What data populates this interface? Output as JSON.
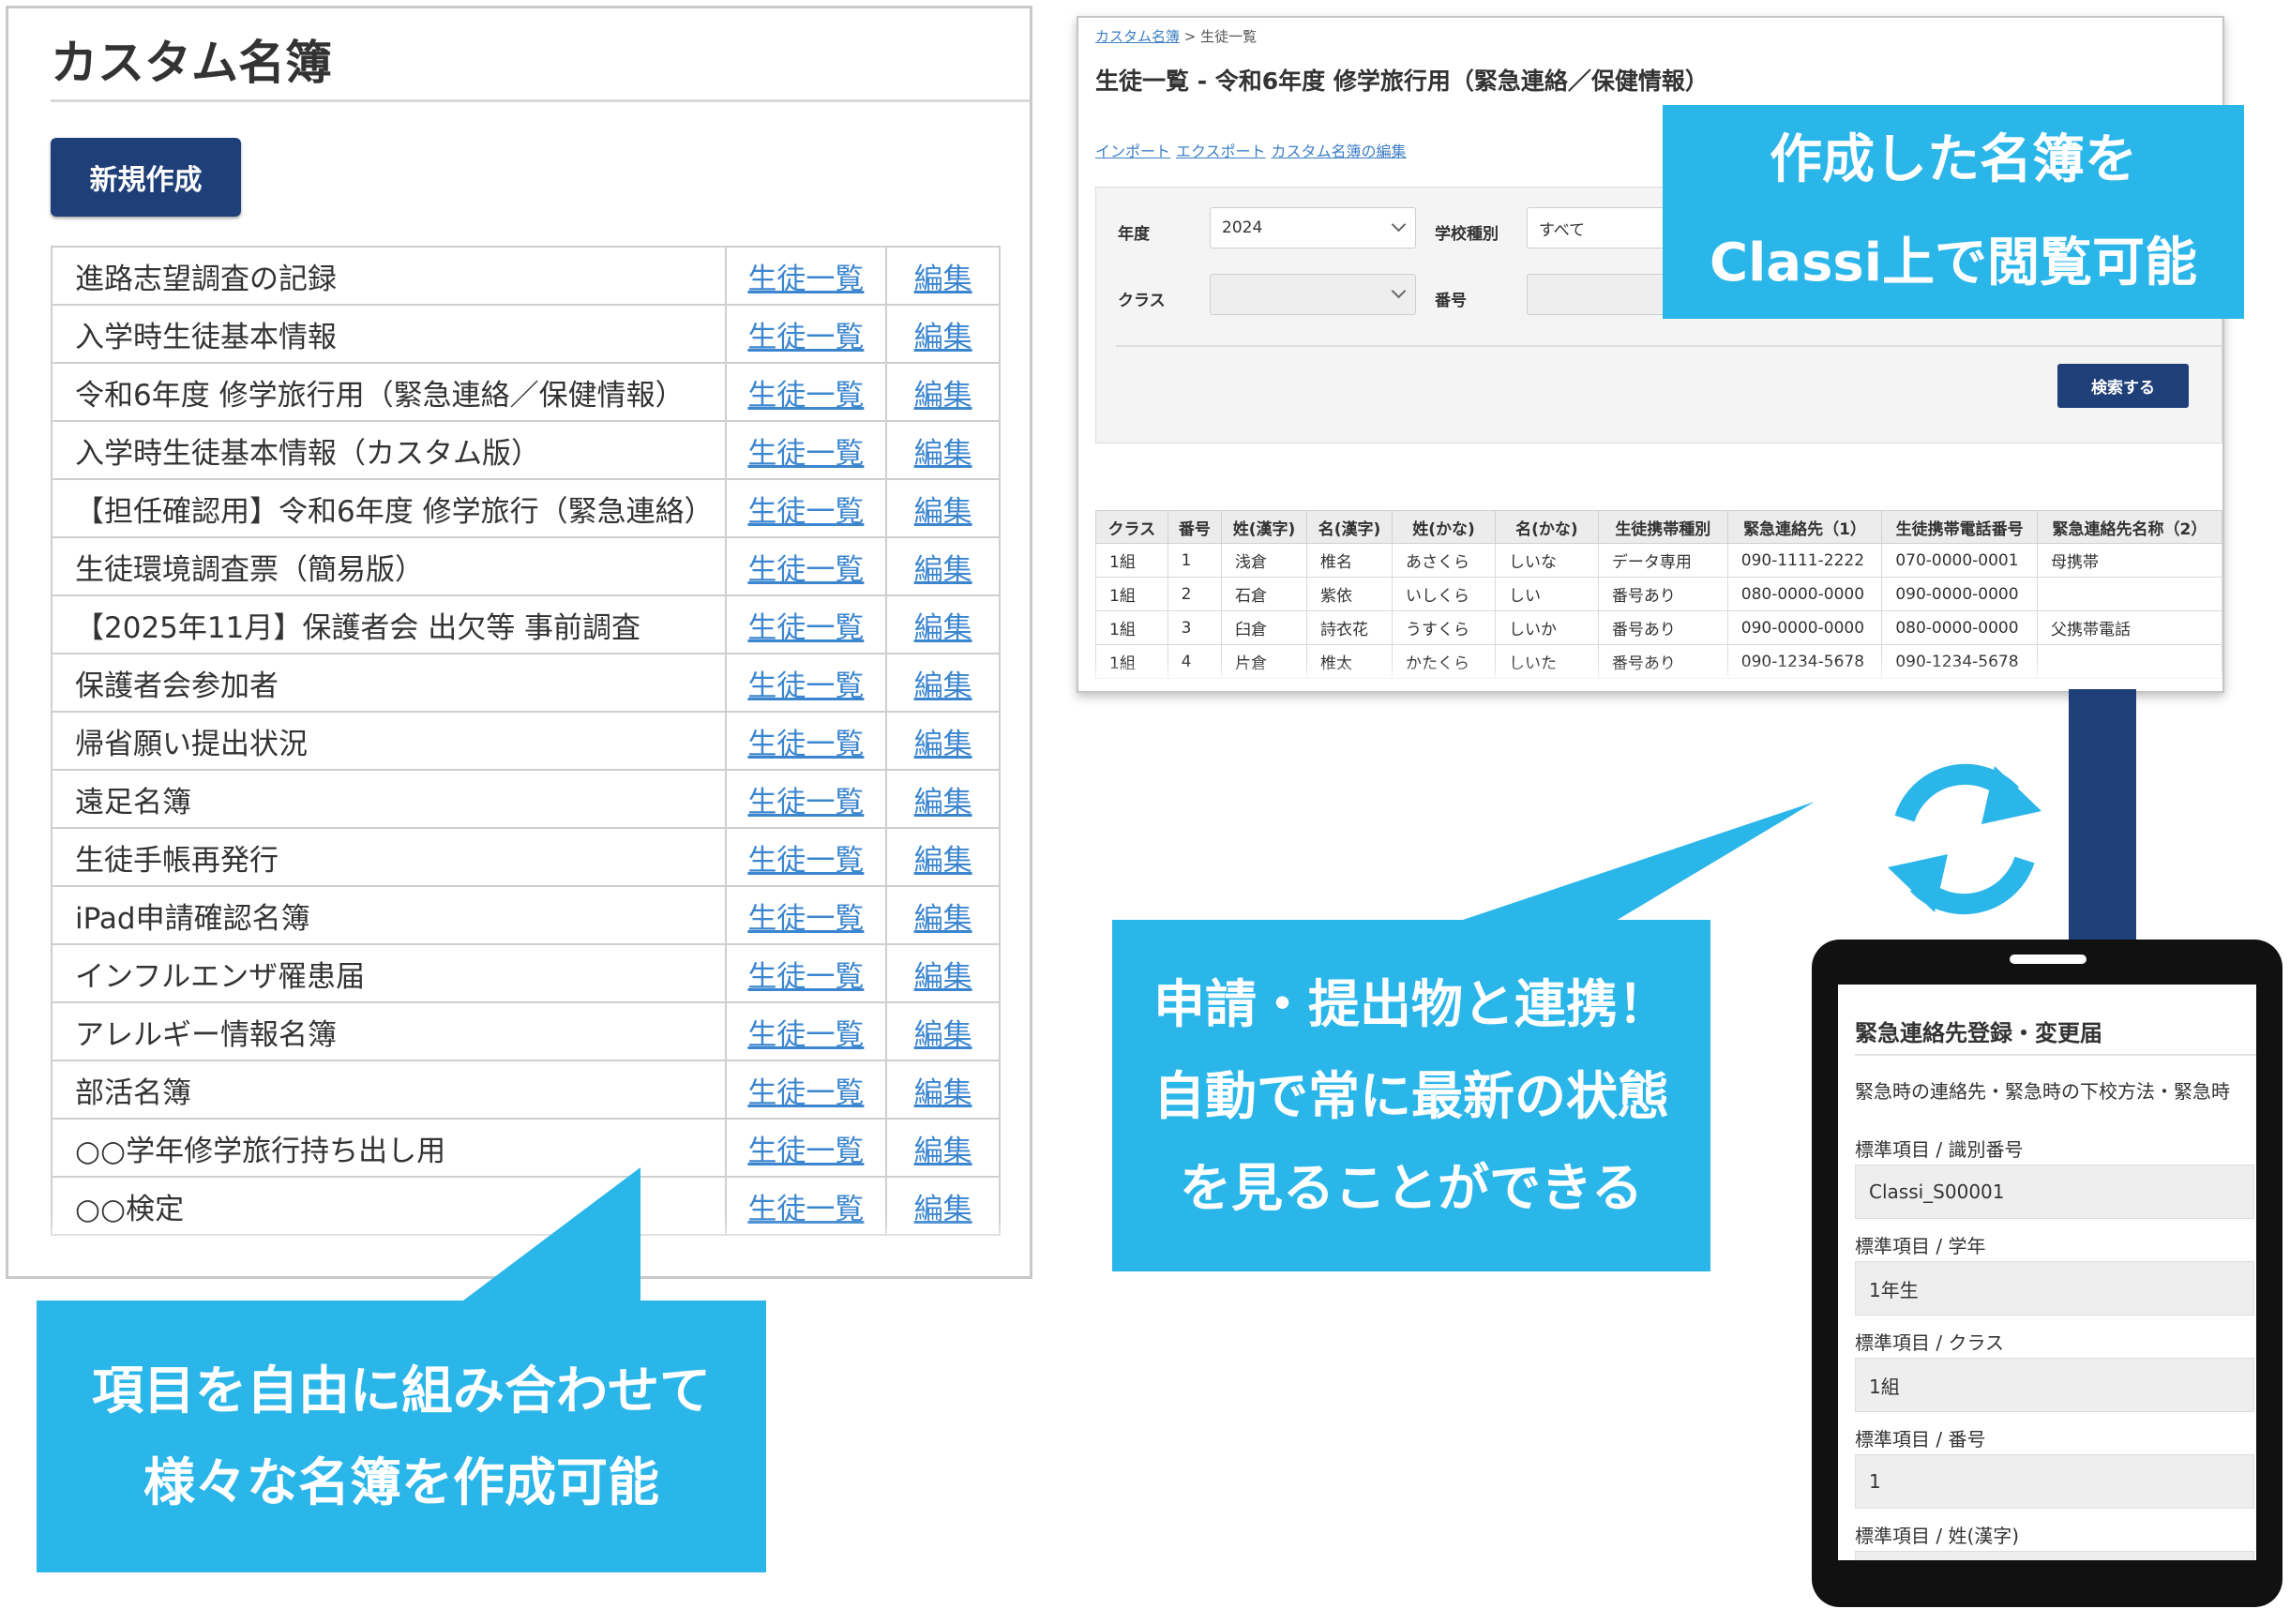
{
  "left_panel": {
    "title": "カスタム名簿",
    "new_button": "新規作成",
    "link_students": "生徒一覧",
    "link_edit": "編集",
    "rosters": [
      "進路志望調査の記録",
      "入学時生徒基本情報",
      "令和6年度 修学旅行用（緊急連絡／保健情報）",
      "入学時生徒基本情報（カスタム版）",
      "【担任確認用】令和6年度 修学旅行（緊急連絡）",
      "生徒環境調査票（簡易版）",
      "【2025年11月】保護者会 出欠等 事前調査",
      "保護者会参加者",
      "帰省願い提出状況",
      "遠足名簿",
      "生徒手帳再発行",
      "iPad申請確認名簿",
      "インフルエンザ罹患届",
      "アレルギー情報名簿",
      "部活名簿",
      "○○学年修学旅行持ち出し用",
      "○○検定"
    ]
  },
  "callouts": {
    "left": [
      "項目を自由に組み合わせて",
      "様々な名簿を作成可能"
    ],
    "middle": [
      "申請・提出物と連携！",
      "自動で常に最新の状態",
      "を見ることができる"
    ],
    "top": [
      "作成した名簿を",
      "Classi上で閲覧可能"
    ]
  },
  "window": {
    "breadcrumb_link": "カスタム名簿",
    "breadcrumb_rest": " > 生徒一覧",
    "title": "生徒一覧 - 令和6年度 修学旅行用（緊急連絡／保健情報）",
    "links": [
      "インポート",
      "エクスポート",
      "カスタム名簿の編集"
    ],
    "filters": {
      "year_label": "年度",
      "year_value": "2024",
      "school_type_label": "学校種別",
      "school_type_value": "すべて",
      "class_label": "クラス",
      "class_value": "",
      "number_label": "番号"
    },
    "search_button": "検索する",
    "table_headers": [
      "クラス",
      "番号",
      "姓(漢字)",
      "名(漢字)",
      "姓(かな)",
      "名(かな)",
      "生徒携帯種別",
      "緊急連絡先（1）",
      "生徒携帯電話番号",
      "緊急連絡先名称（2）"
    ],
    "rows": [
      [
        "1組",
        "1",
        "浅倉",
        "椎名",
        "あさくら",
        "しいな",
        "データ専用",
        "090-1111-2222",
        "070-0000-0001",
        "母携帯"
      ],
      [
        "1組",
        "2",
        "石倉",
        "紫依",
        "いしくら",
        "しい",
        "番号あり",
        "080-0000-0000",
        "090-0000-0000",
        ""
      ],
      [
        "1組",
        "3",
        "臼倉",
        "詩衣花",
        "うすくら",
        "しいか",
        "番号あり",
        "090-0000-0000",
        "080-0000-0000",
        "父携帯電話"
      ],
      [
        "1組",
        "4",
        "片倉",
        "椎太",
        "かたくら",
        "しいた",
        "番号あり",
        "090-1234-5678",
        "090-1234-5678",
        ""
      ]
    ]
  },
  "phone": {
    "form_title": "緊急連絡先登録・変更届",
    "form_description": "緊急時の連絡先・緊急時の下校方法・緊急時",
    "fields": [
      {
        "label": "標準項目 / 識別番号",
        "value": "Classi_S00001"
      },
      {
        "label": "標準項目 / 学年",
        "value": "1年生"
      },
      {
        "label": "標準項目 / クラス",
        "value": "1組"
      },
      {
        "label": "標準項目 / 番号",
        "value": "1"
      },
      {
        "label": "標準項目 / 姓(漢字)",
        "value": ""
      }
    ]
  },
  "colors": {
    "callout": "#2bb6ea",
    "navy": "#1f3f78",
    "link": "#3c86cf"
  },
  "icons": {
    "sync": "sync-arrows-icon"
  }
}
